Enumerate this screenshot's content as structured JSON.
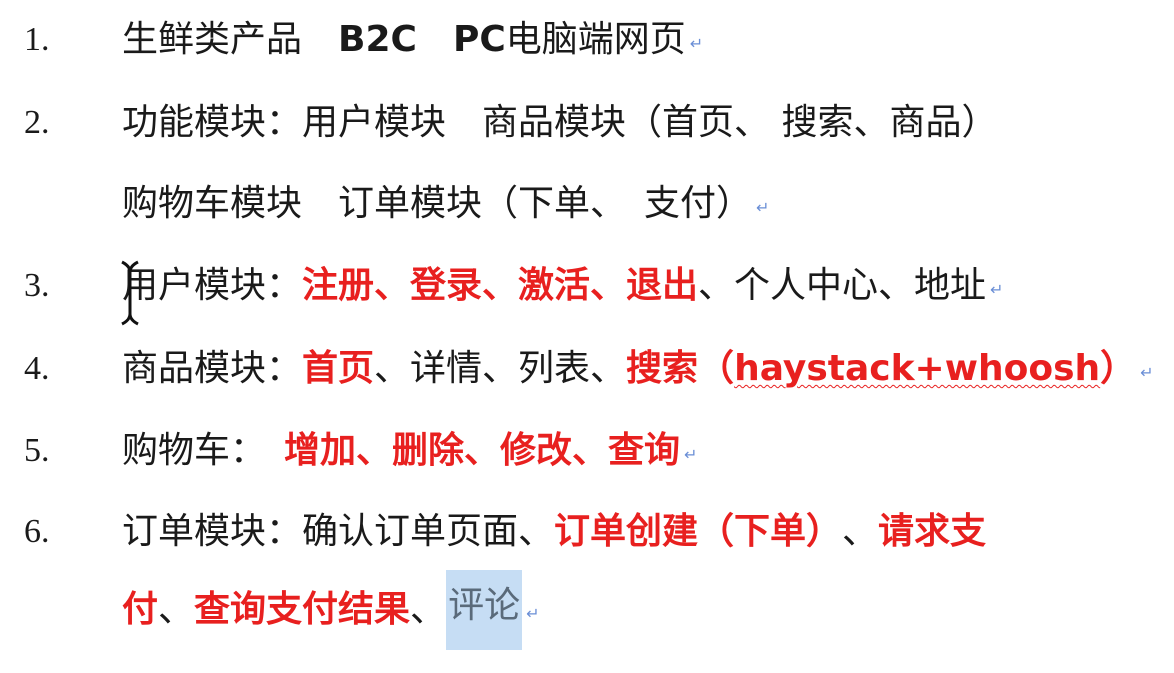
{
  "mark": "↵",
  "items": [
    {
      "num": "1.",
      "segments": [
        {
          "text": "生鲜类产品　",
          "red": false
        },
        {
          "text": "B2C",
          "red": false,
          "latin": true
        },
        {
          "text": "　",
          "red": false
        },
        {
          "text": "PC",
          "red": false,
          "latin": true
        },
        {
          "text": " 电脑端网页",
          "red": false
        }
      ]
    },
    {
      "num": "2.",
      "segments": [
        {
          "text": "功能模块：用户模块　商品模块（首页、 搜索、商品）",
          "red": false
        }
      ]
    },
    {
      "num": "",
      "segments": [
        {
          "text": "购物车模块　订单模块（下单、　支付）",
          "red": false
        }
      ]
    },
    {
      "num": "3.",
      "segments": [
        {
          "text": "用户模块：",
          "red": false
        },
        {
          "text": "注册、登录、激活、退出",
          "red": true
        },
        {
          "text": "、个人中心、地址",
          "red": false
        }
      ]
    },
    {
      "num": "4.",
      "segments": [
        {
          "text": "商品模块：",
          "red": false
        },
        {
          "text": "首页",
          "red": true
        },
        {
          "text": "、详情、列表、",
          "red": false
        },
        {
          "text": "搜索（",
          "red": true
        },
        {
          "text": "haystack+whoosh",
          "red": true,
          "latin": true,
          "squiggle": true
        },
        {
          "text": "）",
          "red": true
        }
      ]
    },
    {
      "num": "5.",
      "segments": [
        {
          "text": "购物车：　",
          "red": false
        },
        {
          "text": "增加、删除、修改、查询",
          "red": true
        }
      ]
    },
    {
      "num": "6.",
      "segments": [
        {
          "text": "订单模块：确认订单页面、",
          "red": false
        },
        {
          "text": "订单创建（下单）",
          "red": true
        },
        {
          "text": "、",
          "red": false
        },
        {
          "text": "请求支",
          "red": true
        }
      ]
    },
    {
      "num": "",
      "segments": [
        {
          "text": "付",
          "red": true
        },
        {
          "text": "、",
          "red": false
        },
        {
          "text": "查询支付结果",
          "red": true
        },
        {
          "text": "、",
          "red": false
        },
        {
          "text": "评论",
          "red": false,
          "highlight": true
        }
      ]
    }
  ]
}
